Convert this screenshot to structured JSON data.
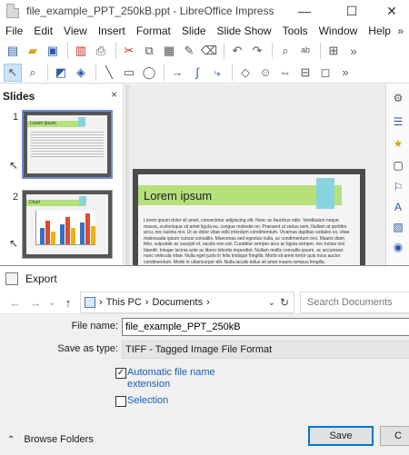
{
  "window": {
    "title": "file_example_PPT_250kB.ppt - LibreOffice Impress",
    "minimize": "—",
    "maximize": "☐",
    "close": "✕"
  },
  "menu": {
    "items": [
      "File",
      "Edit",
      "View",
      "Insert",
      "Format",
      "Slide",
      "Slide Show",
      "Tools",
      "Window",
      "Help"
    ],
    "more": "»"
  },
  "slides_pane": {
    "title": "Slides",
    "close": "×",
    "slides": [
      {
        "number": "1",
        "heading": "Lorem ipsum"
      },
      {
        "number": "2",
        "heading": "Chart"
      }
    ]
  },
  "slide_view": {
    "heading": "Lorem ipsum",
    "body": "Lorem ipsum dolor sit amet, consectetur adipiscing elit. Nunc ac faucibus odio. Vestibulum neque massa, scelerisque sit amet ligula eu, congue molestie mi. Praesent ut varius sem. Nullam at porttitor arcu, nec lacinia nisi. Ut ac dolor vitae odio interdum condimentum. Vivamus dapibus sodales ex, vitae malesuada ipsum cursus convallis. Maecenas sed egestas nulla, ac condimentum orci. Mauris diam felis, vulputate ac suscipit et, iaculis non est. Curabitur semper arcu ac ligula semper, nec luctus nisl blandit. Integer lacinia ante ac libero lobortis imperdiet. Nullam mollis convallis ipsum, ac accumsan nunc vehicula vitae. Nulla eget justo in felis tristique fringilla. Morbi sit amet tortor quis risus auctor condimentum. Morbi in ullamcorper elit. Nulla iaculis tellus sit amet mauris tempus fringilla."
  },
  "dialog": {
    "title": "Export",
    "nav": {
      "back": "←",
      "forward": "→",
      "dropdown": "⌄",
      "up": "↑"
    },
    "address": {
      "crumbs": [
        "This PC",
        "Documents"
      ],
      "separator": "›",
      "dropdown": "⌄",
      "refresh": "↻"
    },
    "search_placeholder": "Search Documents",
    "file_name_label": "File name:",
    "file_name_value": "file_example_PPT_250kB",
    "save_as_type_label": "Save as type:",
    "save_as_type_value": "TIFF - Tagged Image File Format",
    "auto_extension_label_line1": "Automatic file name",
    "auto_extension_label_line2": "extension",
    "auto_extension_checked": true,
    "auto_extension_mark": "✓",
    "selection_label": "Selection",
    "selection_checked": false,
    "browse_folders": "Browse Folders",
    "browse_chevron": "⌃",
    "save_button": "Save",
    "cancel_button": "C"
  }
}
